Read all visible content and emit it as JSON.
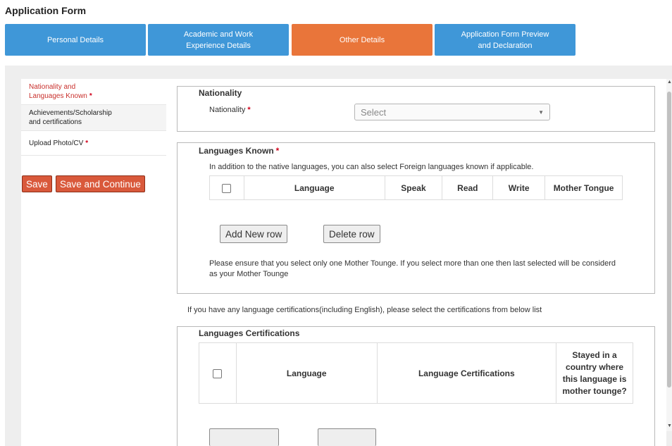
{
  "page": {
    "title": "Application Form"
  },
  "tabs": [
    {
      "line1": "Personal Details",
      "line2": ""
    },
    {
      "line1": "Academic and Work",
      "line2": "Experience Details"
    },
    {
      "line1": "Other Details",
      "line2": ""
    },
    {
      "line1": "Application Form Preview",
      "line2": "and Declaration"
    }
  ],
  "sidebar": {
    "items": [
      {
        "line1": "Nationality and",
        "line2": "Languages Known",
        "required": "*"
      },
      {
        "line1": "Achievements/Scholarship",
        "line2": "and certifications",
        "required": ""
      },
      {
        "line1": "Upload Photo/CV",
        "line2": "",
        "required": "*"
      }
    ],
    "save_label": "Save",
    "save_continue_label": "Save and Continue"
  },
  "nationality": {
    "legend": "Nationality",
    "label": "Nationality",
    "required": "*",
    "select_value": "Select",
    "caret": "▼"
  },
  "languages": {
    "legend": "Languages Known",
    "required": "*",
    "hint": "In addition to the native languages, you can also select Foreign languages known if applicable.",
    "columns": [
      "Language",
      "Speak",
      "Read",
      "Write",
      "Mother Tongue"
    ],
    "add_row_label": "Add New row",
    "delete_row_label": "Delete row",
    "note_line1": "Please ensure that you select only one Mother Tounge. If you select more than one then last selected will be considerd",
    "note_line2": "as your Mother Tounge"
  },
  "certifications": {
    "intro": "If you have any language certifications(including English), please select the certifications from below list",
    "legend": "Languages Certifications",
    "columns": [
      "Language",
      "Language Certifications"
    ],
    "stayed_col": [
      "Stayed in a",
      "country where",
      "this language is",
      "mother tounge?"
    ]
  },
  "colors": {
    "tab_blue": "#3f97d8",
    "tab_active": "#e9753a",
    "save_button": "#d9593b",
    "required": "#d0021b"
  }
}
